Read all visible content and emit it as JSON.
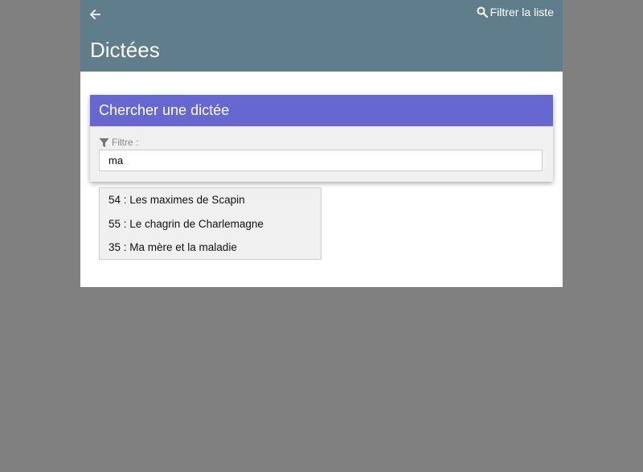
{
  "header": {
    "back_icon": "arrow-left-icon",
    "filter_link_icon": "search-icon",
    "filter_link_label": "Filtrer la liste",
    "title": "Dictées",
    "background_color": "#607d8b"
  },
  "search": {
    "card_title": "Chercher une dictée",
    "card_header_color": "#6767d1",
    "filter_icon": "filter-icon",
    "filter_label": "Filtre :",
    "filter_value": "ma"
  },
  "suggestions": [
    {
      "label": "54 : Les maximes de Scapin"
    },
    {
      "label": "55 : Le chagrin de Charlemagne"
    },
    {
      "label": "35 : Ma mère et la maladie"
    }
  ]
}
